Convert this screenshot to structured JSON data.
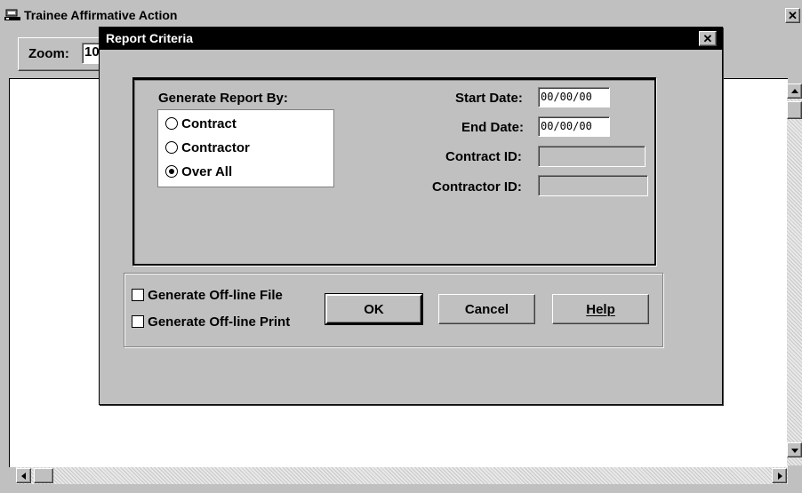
{
  "main_window": {
    "title": "Trainee Affirmative Action",
    "zoom_label": "Zoom:",
    "zoom_value": "10"
  },
  "dialog": {
    "title": "Report Criteria",
    "group_label": "Generate Report By:",
    "options": [
      {
        "label": "Contract",
        "selected": false
      },
      {
        "label": "Contractor",
        "selected": false
      },
      {
        "label": "Over All",
        "selected": true
      }
    ],
    "start_date": {
      "label": "Start Date:",
      "value": "00/00/00"
    },
    "end_date": {
      "label": "End Date:",
      "value": "00/00/00"
    },
    "contract_id": {
      "label": "Contract ID:",
      "value": ""
    },
    "contractor_id": {
      "label": "Contractor ID:",
      "value": ""
    },
    "checkboxes": [
      {
        "label": "Generate Off-line File",
        "checked": false
      },
      {
        "label": "Generate Off-line Print",
        "checked": false
      }
    ],
    "buttons": {
      "ok": "OK",
      "cancel": "Cancel",
      "help": "Help"
    }
  },
  "colors": {
    "title_bar": "#000000",
    "face": "#c0c0c0",
    "field": "#ffffff"
  }
}
